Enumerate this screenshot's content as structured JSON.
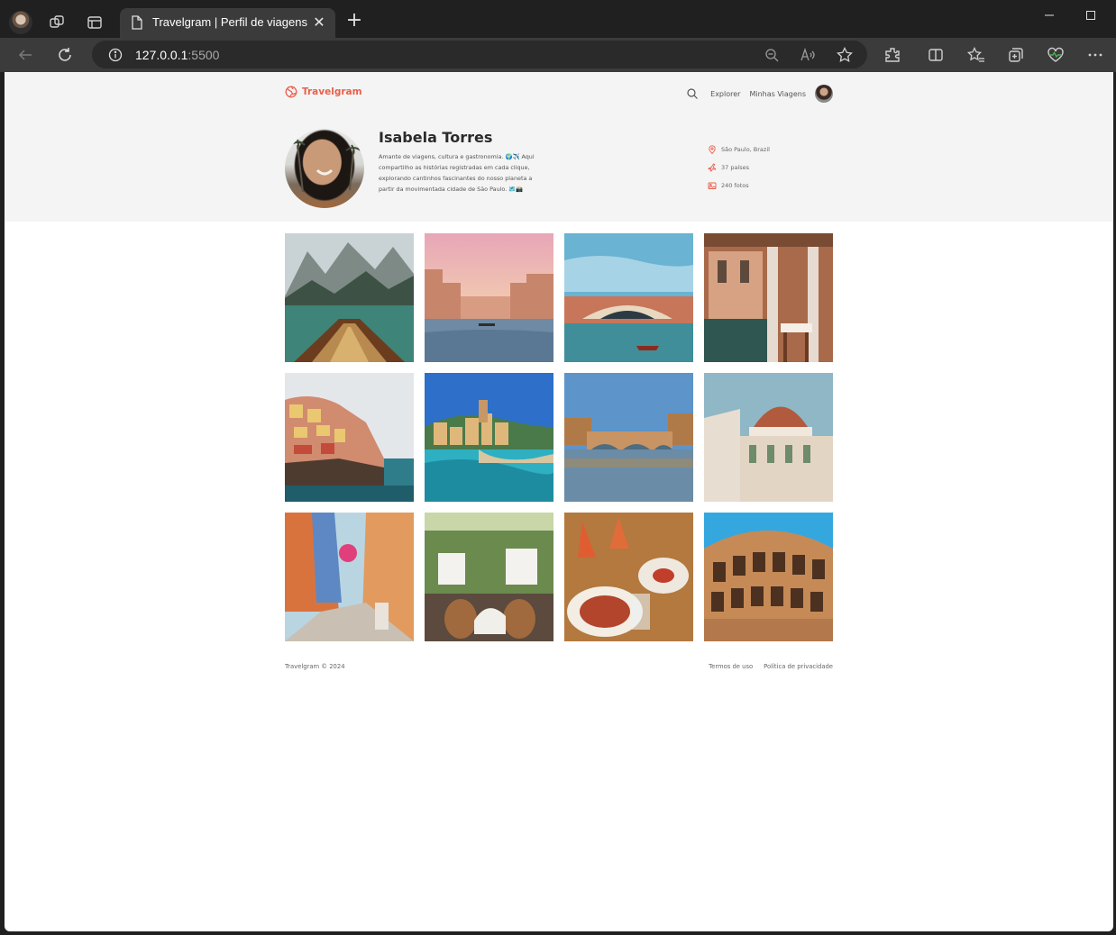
{
  "browser": {
    "tab_title": "Travelgram | Perfil de viagens",
    "url_host": "127.0.0.1",
    "url_port": ":5500",
    "tab_close_glyph": "✕",
    "new_tab_glyph": "+"
  },
  "site": {
    "brand": "Travelgram",
    "accent_color": "#e8604c",
    "nav": {
      "explore_label": "Explorer",
      "trips_label": "Minhas Viagens"
    }
  },
  "profile": {
    "name": "Isabela Torres",
    "bio": "Amante de viagens, cultura e gastronomia. 🌍✈️ Aqui compartilho as histórias registradas em cada clique, explorando cantinhos fascinantes do nosso planeta a partir da movimentada cidade de São Paulo. 🗺️📸",
    "stats": {
      "location": "São Paulo, Brazil",
      "countries": "37 países",
      "photos": "240 fotos"
    }
  },
  "gallery": [
    {
      "name": "photo-lake-boat",
      "icon": "mountain-lake-boat"
    },
    {
      "name": "photo-venice-canal-sunset",
      "icon": "venice-canal"
    },
    {
      "name": "photo-rialto-bridge",
      "icon": "rialto-bridge"
    },
    {
      "name": "photo-venice-terrace",
      "icon": "terrace-restaurant"
    },
    {
      "name": "photo-manarola",
      "icon": "cliff-village"
    },
    {
      "name": "photo-vernazza",
      "icon": "harbor-village"
    },
    {
      "name": "photo-ponte-vecchio",
      "icon": "ponte-vecchio"
    },
    {
      "name": "photo-florence-duomo",
      "icon": "cathedral-dome"
    },
    {
      "name": "photo-alley-scooter",
      "icon": "alley-scooter"
    },
    {
      "name": "photo-cafe-vespa",
      "icon": "cafe-vespa"
    },
    {
      "name": "photo-aperol-dinner",
      "icon": "food-drinks"
    },
    {
      "name": "photo-colosseum",
      "icon": "colosseum"
    }
  ],
  "footer": {
    "copyright": "Travelgram © 2024",
    "terms": "Termos de uso",
    "privacy": "Política de privacidade"
  }
}
